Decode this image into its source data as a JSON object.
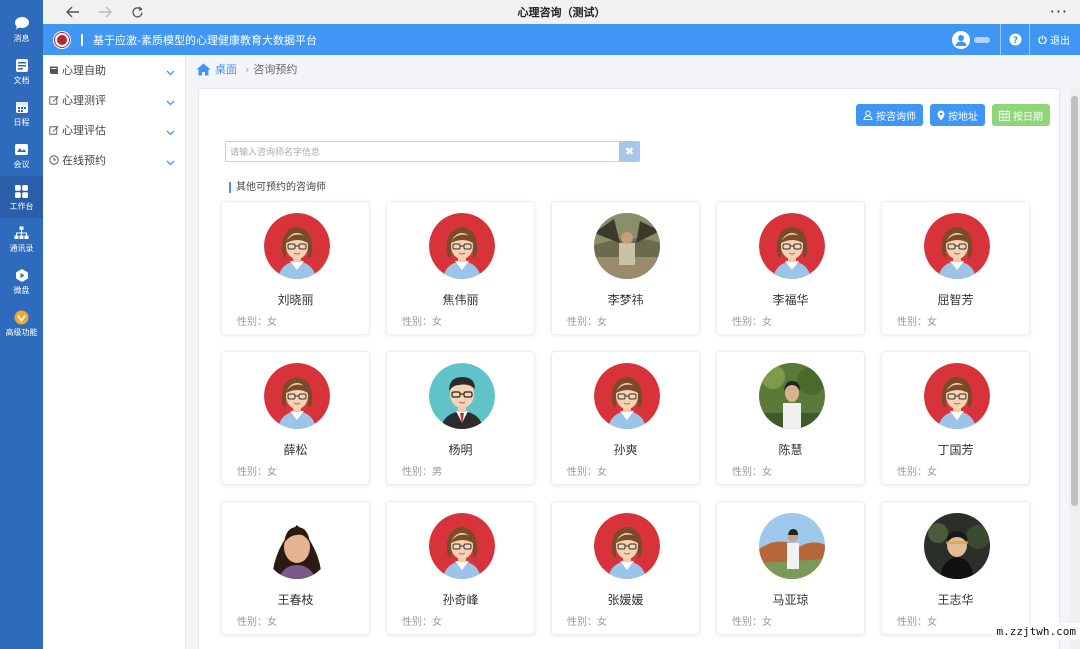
{
  "window": {
    "title": "心理咨询（测试）",
    "more_label": "···"
  },
  "dock": {
    "items": [
      {
        "label": "消息",
        "icon": "chat-bubble-icon"
      },
      {
        "label": "文档",
        "icon": "document-icon"
      },
      {
        "label": "日程",
        "icon": "calendar-icon"
      },
      {
        "label": "会议",
        "icon": "meeting-icon"
      },
      {
        "label": "工作台",
        "icon": "grid-icon",
        "active": true
      },
      {
        "label": "通讯录",
        "icon": "org-chart-icon"
      },
      {
        "label": "微盘",
        "icon": "cloud-drive-icon"
      },
      {
        "label": "高级功能",
        "icon": "premium-icon"
      }
    ]
  },
  "appbar": {
    "title": "基于应激-素质模型的心理健康教育大数据平台",
    "logout_label": "退出",
    "accent": "#3f96f5"
  },
  "sidemenu": {
    "items": [
      {
        "label": "心理自助",
        "icon": "book-icon"
      },
      {
        "label": "心理测评",
        "icon": "edit-icon"
      },
      {
        "label": "心理评估",
        "icon": "edit-icon"
      },
      {
        "label": "在线预约",
        "icon": "clock-icon"
      }
    ]
  },
  "breadcrumb": {
    "home": "桌面",
    "current": "咨询预约"
  },
  "toolbar": {
    "by_counselor": "按咨询师",
    "by_address": "按地址",
    "by_date": "按日期"
  },
  "search": {
    "placeholder": "请输入咨询师名字信息",
    "clear_label": "✖"
  },
  "section_title": "其他可预约的咨询师",
  "gender_prefix": "性别：",
  "counselors": [
    {
      "name": "刘晓丽",
      "gender": "性别：女",
      "avatar": "female-cartoon"
    },
    {
      "name": "焦伟丽",
      "gender": "性别：女",
      "avatar": "female-cartoon"
    },
    {
      "name": "李梦祎",
      "gender": "性别：女",
      "avatar": "photo-outdoor"
    },
    {
      "name": "李福华",
      "gender": "性别：女",
      "avatar": "female-cartoon"
    },
    {
      "name": "屈智芳",
      "gender": "性别：女",
      "avatar": "female-cartoon"
    },
    {
      "name": "薛松",
      "gender": "性别：女",
      "avatar": "female-cartoon"
    },
    {
      "name": "杨明",
      "gender": "性别：男",
      "avatar": "male-cartoon"
    },
    {
      "name": "孙爽",
      "gender": "性别：女",
      "avatar": "female-cartoon"
    },
    {
      "name": "陈慧",
      "gender": "性别：女",
      "avatar": "photo-garden"
    },
    {
      "name": "丁国芳",
      "gender": "性别：女",
      "avatar": "female-cartoon"
    },
    {
      "name": "王春枝",
      "gender": "性别：女",
      "avatar": "photo-portrait"
    },
    {
      "name": "孙奇峰",
      "gender": "性别：女",
      "avatar": "female-cartoon"
    },
    {
      "name": "张媛媛",
      "gender": "性别：女",
      "avatar": "female-cartoon"
    },
    {
      "name": "马亚琼",
      "gender": "性别：女",
      "avatar": "photo-landscape"
    },
    {
      "name": "王志华",
      "gender": "性别：女",
      "avatar": "photo-dark"
    }
  ],
  "watermark": "m.zzjtwh.com"
}
